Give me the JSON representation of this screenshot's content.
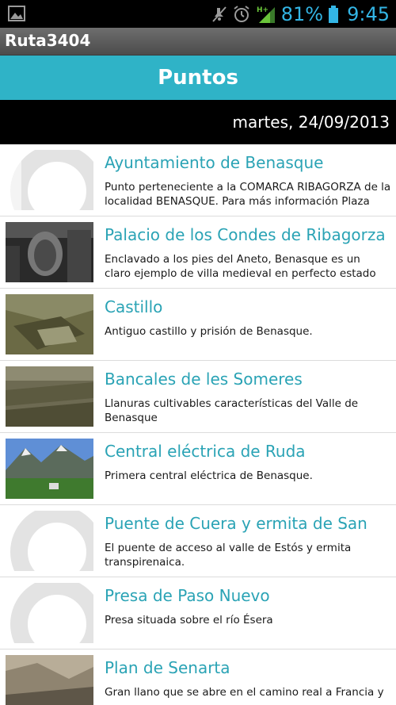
{
  "status_bar": {
    "battery_percent": "81%",
    "time": "9:45",
    "icons": [
      "gallery-icon",
      "mute-icon",
      "alarm-icon",
      "signal-icon",
      "battery-icon"
    ]
  },
  "app": {
    "title": "Ruta3404"
  },
  "header": {
    "title": "Puntos"
  },
  "date": "martes, 24/09/2013",
  "items": [
    {
      "title": "Ayuntamiento de Benasque",
      "desc": "Punto perteneciente a la COMARCA RIBAGORZA de la\nlocalidad BENASQUE. Para más información Plaza",
      "thumb": "placeholder"
    },
    {
      "title": "Palacio de los Condes de Ribagorza",
      "desc": "Enclavado a los pies del Aneto, Benasque es un\nclaro ejemplo de villa medieval en perfecto estado",
      "thumb": "palace"
    },
    {
      "title": "Castillo",
      "desc": "Antiguo castillo y prisión de Benasque.",
      "thumb": "castle"
    },
    {
      "title": "Bancales de les Someres",
      "desc": "Llanuras cultivables características del Valle de\nBenasque",
      "thumb": "terraces"
    },
    {
      "title": "Central eléctrica de Ruda",
      "desc": "Primera central eléctrica de Benasque.",
      "thumb": "mountain"
    },
    {
      "title": "Puente de Cuera y ermita de San",
      "desc": "El puente de acceso al valle de Estós y ermita\ntranspirenaica.",
      "thumb": "placeholder"
    },
    {
      "title": "Presa de Paso Nuevo",
      "desc": "Presa situada sobre el río Ésera",
      "thumb": "placeholder"
    },
    {
      "title": "Plan de Senarta",
      "desc": "Gran llano que se abre en el camino real a Francia y",
      "thumb": "valley"
    }
  ]
}
